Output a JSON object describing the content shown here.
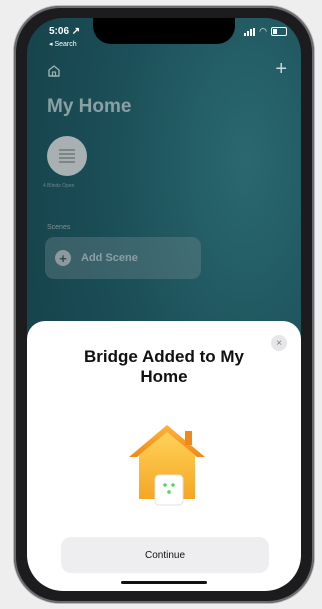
{
  "status_bar": {
    "time": "5:06 ↗",
    "back_label": "◂ Search"
  },
  "header": {
    "title": "My Home",
    "plus": "+"
  },
  "accessory": {
    "status": "4 Blinds Open"
  },
  "scenes": {
    "section_label": "Scenes",
    "add_label": "Add Scene",
    "add_symbol": "+"
  },
  "sheet": {
    "title": "Bridge Added to My Home",
    "close_symbol": "×",
    "continue_label": "Continue"
  },
  "colors": {
    "accent_home": "#f6a623",
    "sheet_bg": "#ffffff",
    "screen_bg": "#1b4e57"
  }
}
